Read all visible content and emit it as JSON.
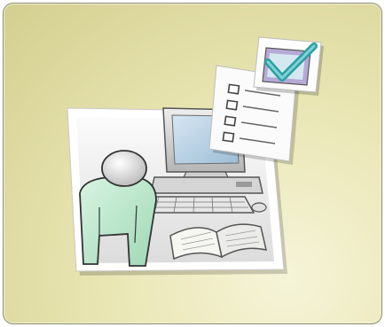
{
  "illustration": {
    "icon": "user-computer-checklist-illustration",
    "colors": {
      "tile_background": "#e6e2ab",
      "photo_frame": "#ffffff",
      "person_body": "#bfe8cf",
      "person_head": "#e3e3e3",
      "monitor": "#d9d9d9",
      "screen": "#bcd3e6",
      "checkmark": "#3aaab0",
      "clipboard_accent": "#8c7bb8"
    }
  }
}
